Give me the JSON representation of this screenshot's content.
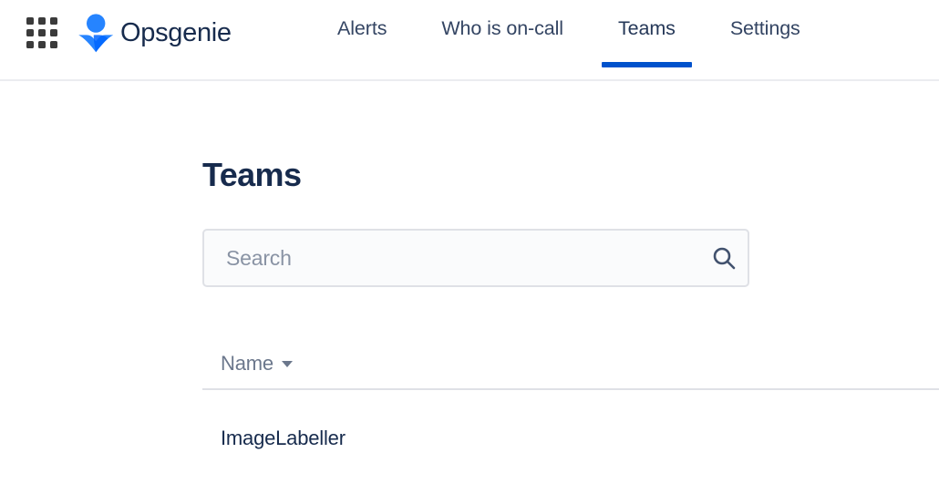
{
  "header": {
    "app_switcher_icon": "grid-apps-icon",
    "logo_icon": "opsgenie-logo-icon",
    "brand_name": "Opsgenie",
    "brand_color": "#2684ff",
    "text_color": "#172b4d",
    "nav": [
      {
        "label": "Alerts",
        "active": false
      },
      {
        "label": "Who is on-call",
        "active": false
      },
      {
        "label": "Teams",
        "active": true
      },
      {
        "label": "Settings",
        "active": false
      }
    ],
    "active_indicator_color": "#0052cc"
  },
  "main": {
    "page_title": "Teams",
    "search": {
      "value": "",
      "placeholder": "Search",
      "icon": "search-icon",
      "background": "#fafbfc",
      "border_color": "#dfe1e6"
    },
    "table": {
      "columns": [
        {
          "label": "Name",
          "sort_icon": "chevron-down-icon",
          "sorted": true
        }
      ],
      "rows": [
        {
          "name": "ImageLabeller"
        }
      ],
      "divider_color": "#dfe1e6"
    }
  }
}
